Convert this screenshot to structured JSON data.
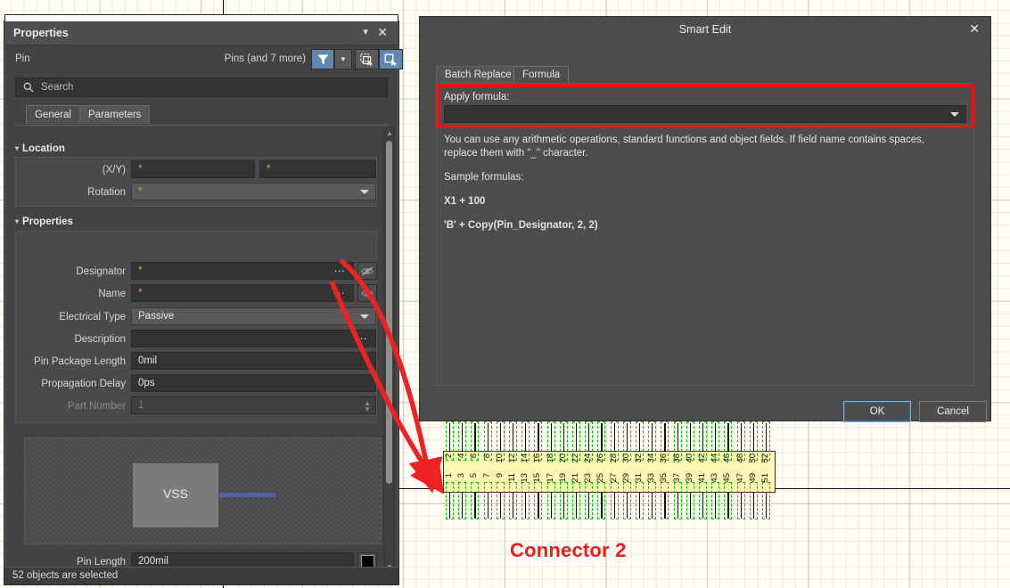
{
  "canvas": {
    "connector": {
      "label": "Connector 2",
      "label_color": "#f01c1c",
      "body_color": "#fdf8b4",
      "body_border_color": "#7a1010",
      "selection_color": "#00c000",
      "top_row_pins": [
        2,
        4,
        6,
        8,
        10,
        12,
        14,
        16,
        18,
        20,
        22,
        24,
        26,
        28,
        30,
        32,
        34,
        36,
        38,
        40,
        42,
        44,
        46,
        48,
        50,
        52
      ],
      "bottom_row_pins": [
        1,
        3,
        5,
        7,
        9,
        11,
        13,
        15,
        17,
        19,
        21,
        23,
        25,
        27,
        29,
        31,
        33,
        35,
        37,
        39,
        41,
        43,
        45,
        47,
        49,
        51
      ]
    }
  },
  "properties_panel": {
    "title": "Properties",
    "object_type": "Pin",
    "object_count": "Pins (and 7 more)",
    "search_placeholder": "Search",
    "tabs": [
      {
        "label": "General",
        "selected": true
      },
      {
        "label": "Parameters",
        "selected": false
      }
    ],
    "sections": {
      "location": {
        "title": "Location",
        "fields": [
          {
            "label": "(X/Y)",
            "value_x": "*",
            "value_y": "*"
          },
          {
            "label": "Rotation",
            "value": "*"
          }
        ]
      },
      "properties": {
        "title": "Properties",
        "fields": [
          {
            "label": "Designator",
            "value": "*",
            "has_dots": true,
            "has_eye": true
          },
          {
            "label": "Name",
            "value": "*",
            "has_dots": true,
            "has_eye": true
          },
          {
            "label": "Electrical Type",
            "value": "Passive",
            "type": "combo"
          },
          {
            "label": "Description",
            "value": "",
            "has_dots": true
          },
          {
            "label": "Pin Package Length",
            "value": "0mil"
          },
          {
            "label": "Propagation Delay",
            "value": "0ps"
          },
          {
            "label": "Part Number",
            "value": "1",
            "disabled": true
          }
        ]
      }
    },
    "preview": {
      "symbol_label": "VSS",
      "wire_color": "#4f5fa8"
    },
    "pin_length": {
      "label": "Pin Length",
      "value": "200mil",
      "swatch_color": "#000000"
    },
    "status": "52 objects are selected"
  },
  "smart_edit_dialog": {
    "title": "Smart Edit",
    "close_label": "✕",
    "tabs": [
      {
        "label": "Batch Replace",
        "selected": false
      },
      {
        "label": "Formula",
        "selected": true
      }
    ],
    "apply_formula_label": "Apply formula:",
    "formula_value": "",
    "highlight_color": "#ee1111",
    "help_paragraph": "You can use any arithmetic operations, standard functions and object fields. If field name contains spaces, replace them with \"_\" character.",
    "samples_heading": "Sample formulas:",
    "sample_1": "X1 + 100",
    "sample_2": "'B' + Copy(Pin_Designator, 2, 2)",
    "ok_label": "OK",
    "cancel_label": "Cancel"
  },
  "annotations": {
    "arrow_color": "#ee2222",
    "arrow_count": 2
  }
}
